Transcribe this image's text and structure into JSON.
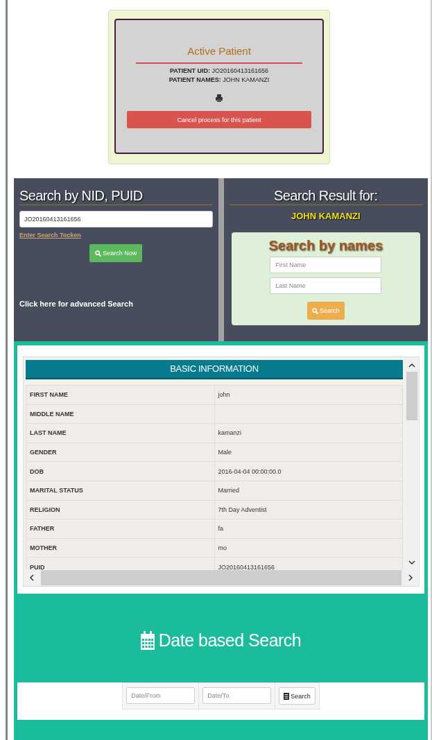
{
  "active_patient": {
    "title": "Active Patient",
    "uid_label": "PATIENT UID:",
    "uid": "JO20160413161656",
    "names_label": "PATIENT NAMES:",
    "names": "JOHN KAMANZI",
    "cancel_button": "Cancel process for this patient"
  },
  "id_search": {
    "title": "Search by NID, PUID",
    "value": "JO20160413161656",
    "hint_link": "Enter Search Tocken",
    "button": "Search Now",
    "advanced_link": "Click here for advanced Search"
  },
  "result": {
    "title": "Search Result for:",
    "name": "JOHN KAMANZI"
  },
  "name_search": {
    "title": "Search by names",
    "first_placeholder": "First Name",
    "last_placeholder": "Last Name",
    "button": "Search"
  },
  "basic_information": {
    "title": "BASIC INFORMATION",
    "rows": [
      {
        "label": "FIRST NAME",
        "value": "john"
      },
      {
        "label": "MIDDLE NAME"
      },
      {
        "label": "LAST NAME",
        "value": "kamanzi"
      },
      {
        "label": "GENDER",
        "value": "Male"
      },
      {
        "label": "DOB",
        "value": "2016-04-04 00:00:00.0"
      },
      {
        "label": "MARITAL STATUS",
        "value": "Married"
      },
      {
        "label": "RELIGION",
        "value": "7th Day Adventist"
      },
      {
        "label": "FATHER",
        "value": "fa"
      },
      {
        "label": "MOTHER",
        "value": "mo"
      },
      {
        "label": "PUID",
        "value": "JO20160413161656"
      }
    ]
  },
  "date_search": {
    "title": "Date based Search",
    "from_placeholder": "Date/From",
    "to_placeholder": "Date/To",
    "button": "Search"
  }
}
